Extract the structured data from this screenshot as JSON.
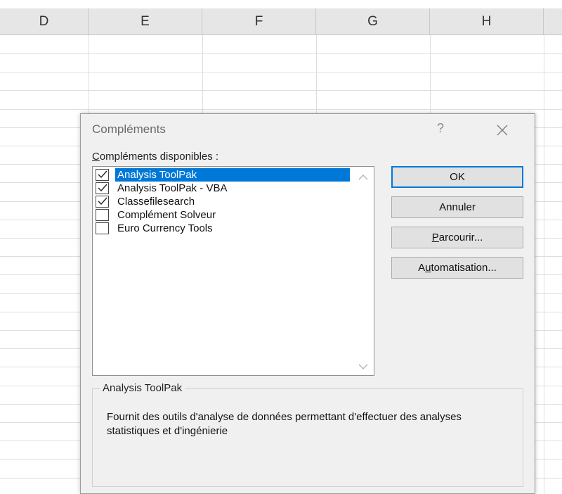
{
  "spreadsheet": {
    "columns": [
      "D",
      "E",
      "F",
      "G",
      "H"
    ]
  },
  "dialog": {
    "title": "Compléments",
    "help_glyph": "?",
    "available_label_first": "C",
    "available_label_rest": "ompléments disponibles :",
    "addins": [
      {
        "label": "Analysis ToolPak",
        "checked": true,
        "selected": true
      },
      {
        "label": "Analysis ToolPak - VBA",
        "checked": true,
        "selected": false
      },
      {
        "label": "Classefilesearch",
        "checked": true,
        "selected": false
      },
      {
        "label": "Complément Solveur",
        "checked": false,
        "selected": false
      },
      {
        "label": "Euro Currency Tools",
        "checked": false,
        "selected": false
      }
    ],
    "buttons": {
      "ok": "OK",
      "cancel": "Annuler",
      "browse_first": "P",
      "browse_rest": "arcourir...",
      "automation_first": "A",
      "automation_mid": "u",
      "automation_rest": "tomatisation..."
    },
    "description": {
      "title": "Analysis ToolPak",
      "text": "Fournit des outils d'analyse de données permettant d'effectuer des analyses statistiques et d'ingénierie"
    },
    "accent_color": "#0078d7"
  }
}
